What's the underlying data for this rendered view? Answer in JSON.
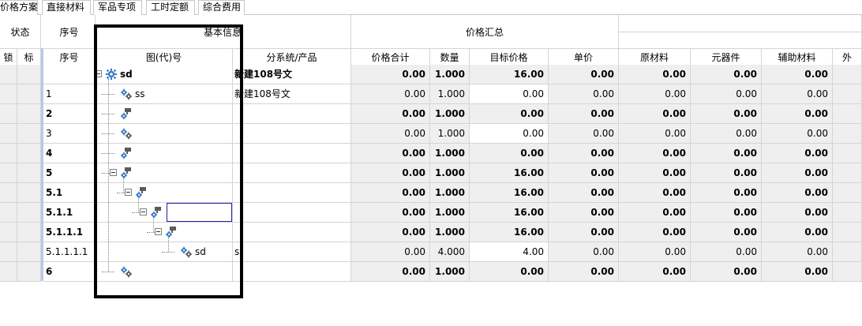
{
  "tabs": [
    "价格方案",
    "直接材料",
    "军品专项",
    "工时定额",
    "综合费用"
  ],
  "group_headers": {
    "status": "状态",
    "seq": "序号",
    "basic_info": "基本信息",
    "price_summary": "价格汇总"
  },
  "columns": {
    "lock": "锁",
    "mark": "标",
    "seq": "序号",
    "drawing_no": "图(代)号",
    "subsystem": "分系统/产品",
    "price_total": "价格合计",
    "quantity": "数量",
    "target_price": "目标价格",
    "unit_price": "单价",
    "raw_material": "原材料",
    "components": "元器件",
    "aux_material": "辅助材料",
    "other": "外"
  },
  "rows": [
    {
      "seq": "",
      "drawing": "sd",
      "subsystem": "新建108号文",
      "price_total": "0.00",
      "quantity": "1.000",
      "target_price": "16.00",
      "unit_price": "0.00",
      "raw": "0.00",
      "comp": "0.00",
      "aux": "0.00"
    },
    {
      "seq": "1",
      "drawing": "ss",
      "subsystem": "新建108号文",
      "price_total": "0.00",
      "quantity": "1.000",
      "target_price": "0.00",
      "unit_price": "0.00",
      "raw": "0.00",
      "comp": "0.00",
      "aux": "0.00"
    },
    {
      "seq": "2",
      "drawing": "",
      "subsystem": "",
      "price_total": "0.00",
      "quantity": "1.000",
      "target_price": "0.00",
      "unit_price": "0.00",
      "raw": "0.00",
      "comp": "0.00",
      "aux": "0.00"
    },
    {
      "seq": "3",
      "drawing": "",
      "subsystem": "",
      "price_total": "0.00",
      "quantity": "1.000",
      "target_price": "0.00",
      "unit_price": "0.00",
      "raw": "0.00",
      "comp": "0.00",
      "aux": "0.00"
    },
    {
      "seq": "4",
      "drawing": "",
      "subsystem": "",
      "price_total": "0.00",
      "quantity": "1.000",
      "target_price": "0.00",
      "unit_price": "0.00",
      "raw": "0.00",
      "comp": "0.00",
      "aux": "0.00"
    },
    {
      "seq": "5",
      "drawing": "",
      "subsystem": "",
      "price_total": "0.00",
      "quantity": "1.000",
      "target_price": "16.00",
      "unit_price": "0.00",
      "raw": "0.00",
      "comp": "0.00",
      "aux": "0.00"
    },
    {
      "seq": "5.1",
      "drawing": "",
      "subsystem": "",
      "price_total": "0.00",
      "quantity": "1.000",
      "target_price": "16.00",
      "unit_price": "0.00",
      "raw": "0.00",
      "comp": "0.00",
      "aux": "0.00"
    },
    {
      "seq": "5.1.1",
      "drawing": "",
      "subsystem": "",
      "price_total": "0.00",
      "quantity": "1.000",
      "target_price": "16.00",
      "unit_price": "0.00",
      "raw": "0.00",
      "comp": "0.00",
      "aux": "0.00"
    },
    {
      "seq": "5.1.1.1",
      "drawing": "",
      "subsystem": "",
      "price_total": "0.00",
      "quantity": "1.000",
      "target_price": "16.00",
      "unit_price": "0.00",
      "raw": "0.00",
      "comp": "0.00",
      "aux": "0.00"
    },
    {
      "seq": "5.1.1.1.1",
      "drawing": "sd",
      "subsystem": "s(",
      "price_total": "0.00",
      "quantity": "4.000",
      "target_price": "4.00",
      "unit_price": "0.00",
      "raw": "0.00",
      "comp": "0.00",
      "aux": "0.00"
    },
    {
      "seq": "6",
      "drawing": "",
      "subsystem": "",
      "price_total": "0.00",
      "quantity": "1.000",
      "target_price": "0.00",
      "unit_price": "0.00",
      "raw": "0.00",
      "comp": "0.00",
      "aux": "0.00"
    }
  ],
  "icons": {
    "root": "gear-icon",
    "node": "gears-icon",
    "assembly": "assembly-gears-icon",
    "expander": "collapse-icon"
  },
  "colors": {
    "shade": "#efefef",
    "grid_line": "#d4d4d4",
    "selection_border": "#2020a0",
    "gear_blue": "#3a7bc8"
  }
}
